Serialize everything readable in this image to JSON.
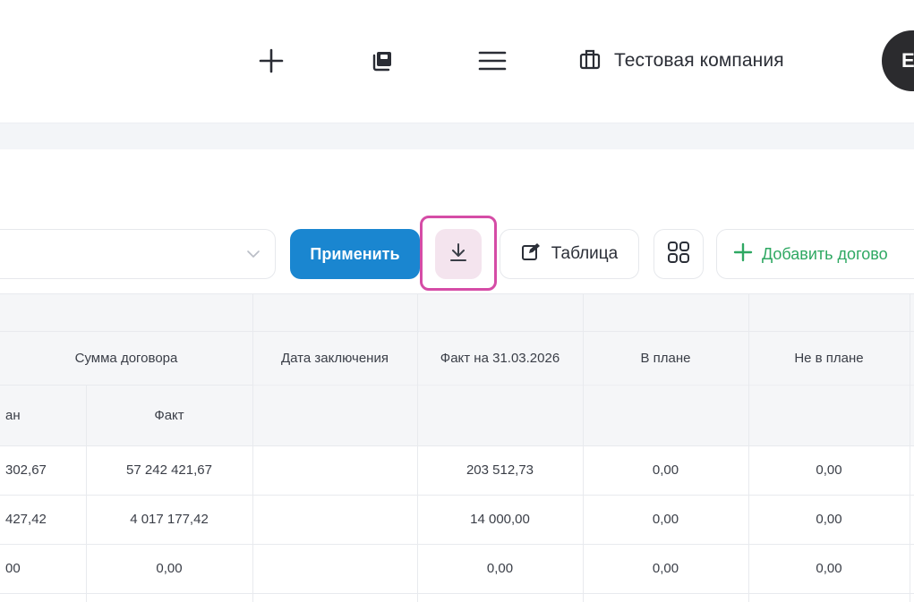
{
  "header": {
    "icons": [
      "plus-icon",
      "copy-icon",
      "menu-icon",
      "building-icon"
    ],
    "company_name": "Тестовая компания",
    "avatar_letter": "Е"
  },
  "toolbar": {
    "select_value": "",
    "apply_label": "Применить",
    "download_icon": "download-icon",
    "table_label": "Таблица",
    "grid_icon": "grid-icon",
    "add_label": "Добавить догово"
  },
  "table": {
    "headers": {
      "contract_sum": "Сумма договора",
      "plan_sub": "ан",
      "fact_sub": "Факт",
      "conclusion_date": "Дата заключения",
      "fact_on_date": "Факт на 31.03.2026",
      "in_plan": "В плане",
      "not_in_plan": "Не в плане"
    },
    "rows": [
      {
        "plan": "302,67",
        "fact": "57 242 421,67",
        "date": "",
        "fact_on_date": "203 512,73",
        "in_plan": "0,00",
        "not_in_plan": "0,00"
      },
      {
        "plan": "427,42",
        "fact": "4 017 177,42",
        "date": "",
        "fact_on_date": "14 000,00",
        "in_plan": "0,00",
        "not_in_plan": "0,00"
      },
      {
        "plan": "00",
        "fact": "0,00",
        "date": "",
        "fact_on_date": "0,00",
        "in_plan": "0,00",
        "not_in_plan": "0,00"
      }
    ]
  },
  "colors": {
    "apply_bg": "#1a86d0",
    "highlight_frame": "#d54ca6",
    "download_bg": "#f4e4ee",
    "add_green": "#2ea862"
  }
}
